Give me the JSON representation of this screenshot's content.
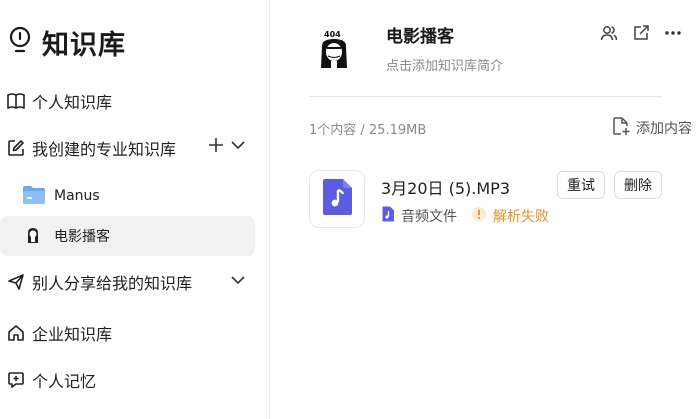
{
  "sidebar": {
    "brand_title": "知识库",
    "personal": "个人知识库",
    "my_created": "我创建的专业知识库",
    "kb_items": [
      {
        "label": "Manus",
        "icon": "folder-icon"
      },
      {
        "label": "电影播客",
        "icon": "avatar-404"
      }
    ],
    "shared": "别人分享给我的知识库",
    "enterprise": "企业知识库",
    "memory": "个人记忆"
  },
  "header": {
    "avatar_text": "404",
    "title": "电影播客",
    "description": "点击添加知识库简介"
  },
  "content": {
    "meta": "1个内容 / 25.19MB",
    "add_label": "添加内容",
    "file": {
      "name": "3月20日 (5).MP3",
      "type": "音频文件",
      "status": "解析失败",
      "retry": "重试",
      "delete": "删除"
    }
  },
  "colors": {
    "accent": "#5b5ce0",
    "folder": "#6aa9ea",
    "warning": "#e8912d",
    "active_bg": "#f1f1f1"
  }
}
